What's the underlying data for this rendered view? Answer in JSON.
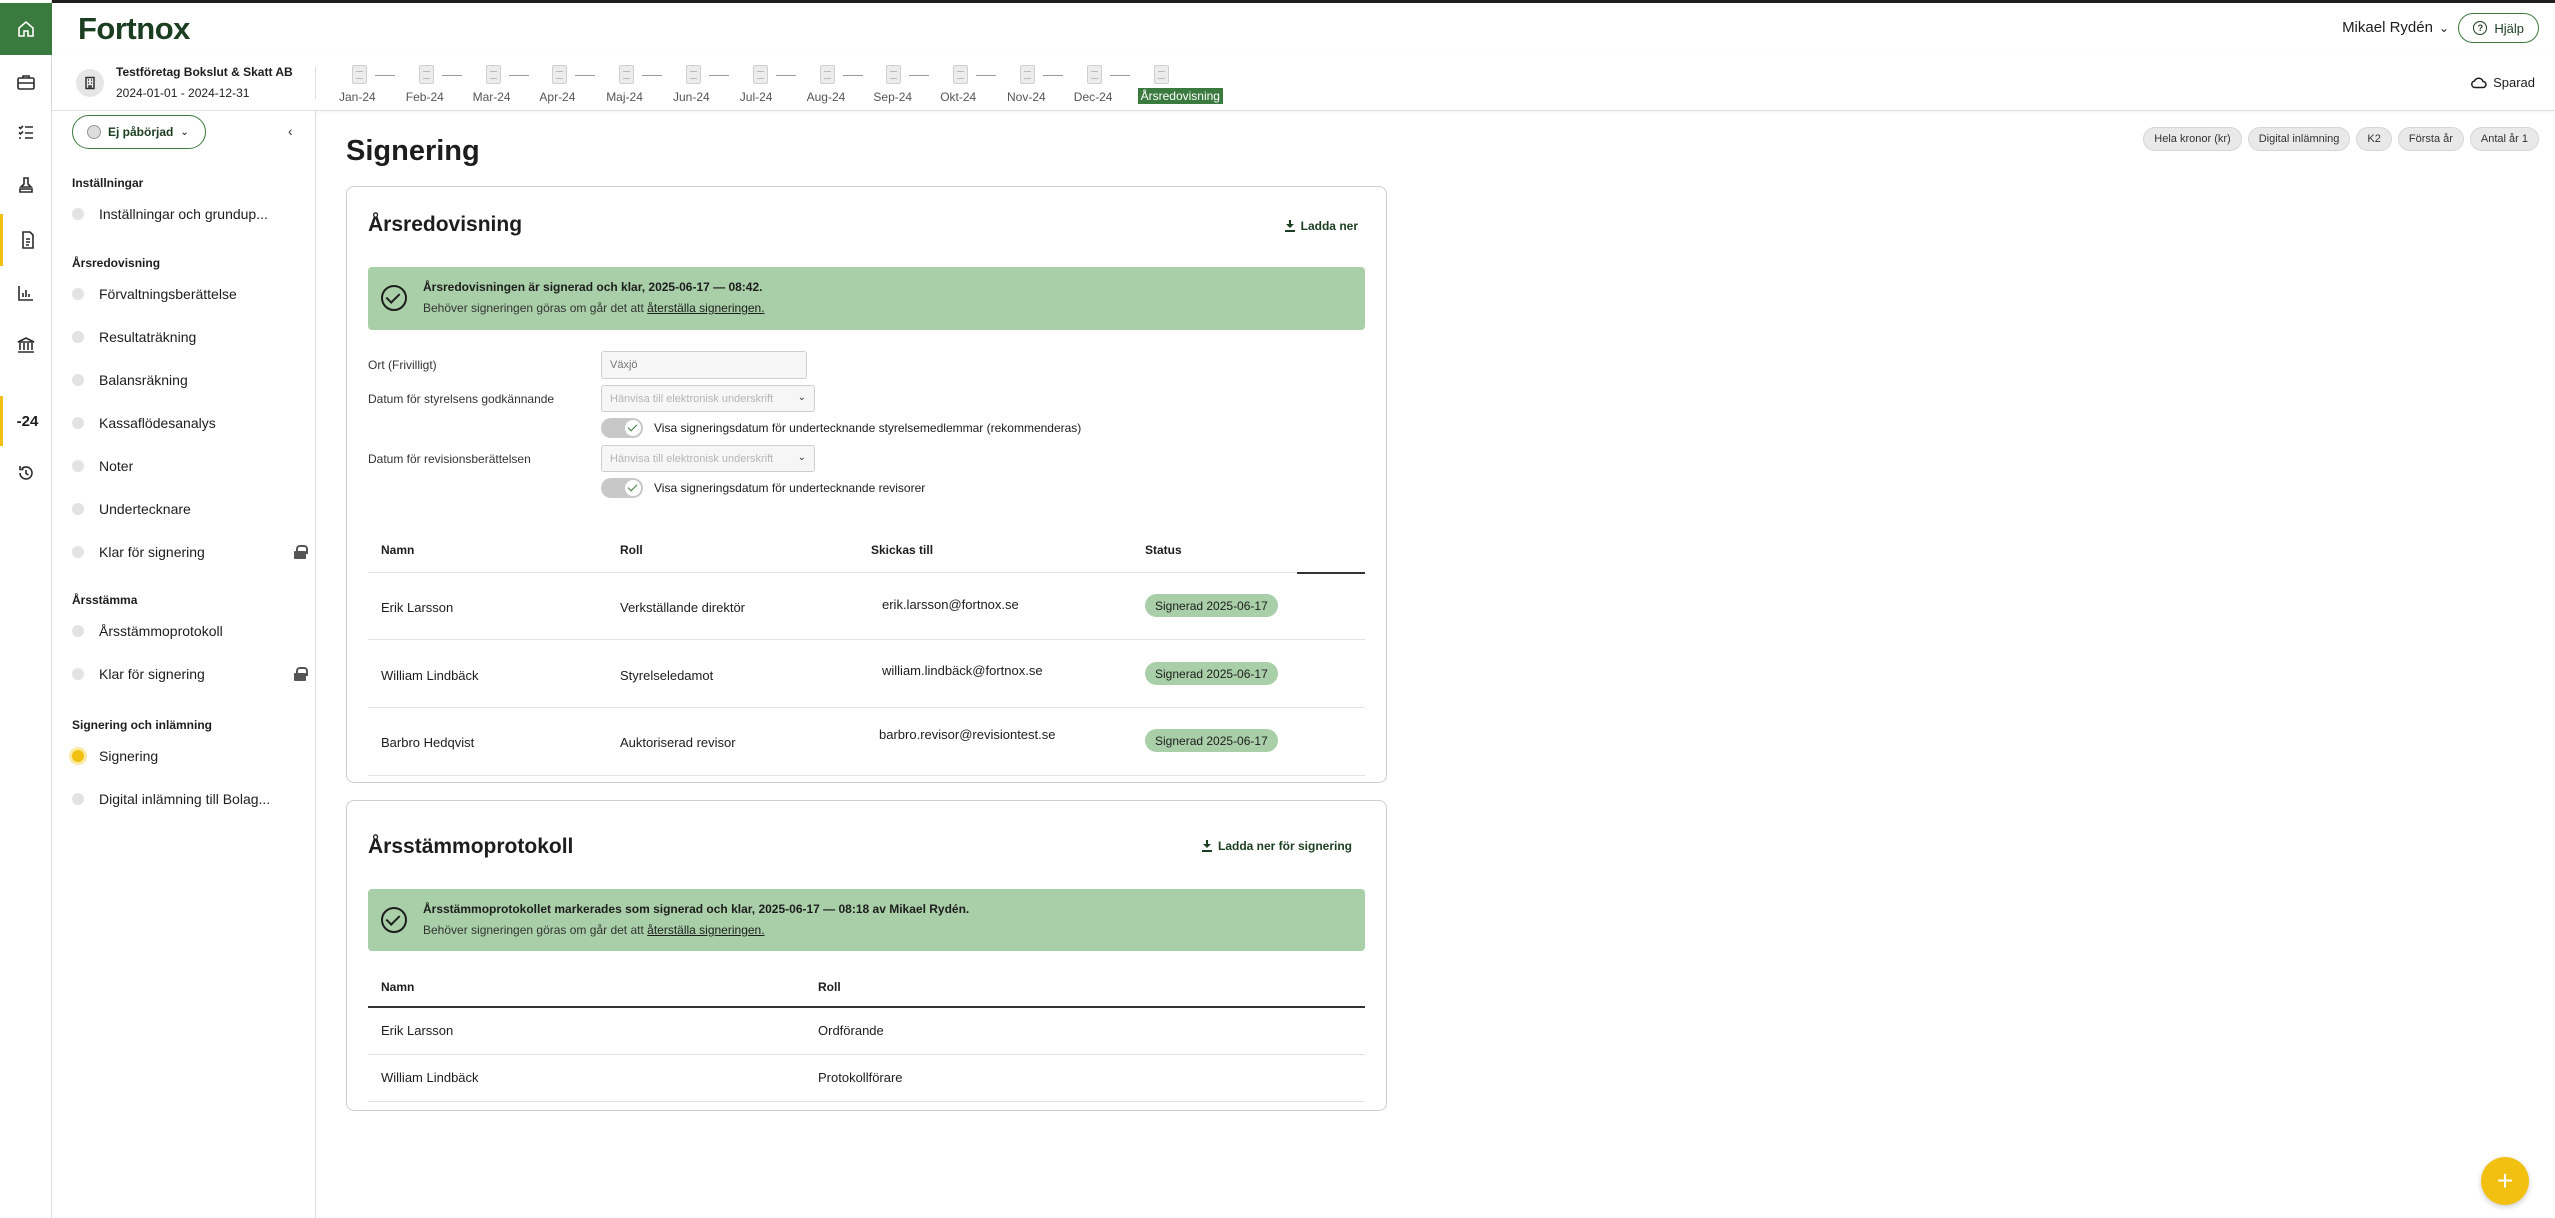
{
  "app": {
    "logo": "Fortnox"
  },
  "header": {
    "user_name": "Mikael Rydén",
    "help_label": "Hjälp"
  },
  "subheader": {
    "company_name": "Testföretag Bokslut & Skatt AB",
    "period": "2024-01-01 - 2024-12-31",
    "months": [
      "Jan-24",
      "Feb-24",
      "Mar-24",
      "Apr-24",
      "Maj-24",
      "Jun-24",
      "Jul-24",
      "Aug-24",
      "Sep-24",
      "Okt-24",
      "Nov-24",
      "Dec-24",
      "Årsredovisning"
    ],
    "active_month_index": 12,
    "saved_label": "Sparad"
  },
  "rail": {
    "year_label": "-24"
  },
  "sidebar": {
    "status_label": "Ej påbörjad",
    "sections": [
      {
        "title": "Inställningar",
        "items": [
          {
            "label": "Inställningar och grundup...",
            "locked": false
          }
        ]
      },
      {
        "title": "Årsredovisning",
        "items": [
          {
            "label": "Förvaltningsberättelse",
            "locked": false
          },
          {
            "label": "Resultaträkning",
            "locked": false
          },
          {
            "label": "Balansräkning",
            "locked": false
          },
          {
            "label": "Kassaflödesanalys",
            "locked": false
          },
          {
            "label": "Noter",
            "locked": false
          },
          {
            "label": "Undertecknare",
            "locked": false
          },
          {
            "label": "Klar för signering",
            "locked": true
          }
        ]
      },
      {
        "title": "Årsstämma",
        "items": [
          {
            "label": "Årsstämmoprotokoll",
            "locked": false
          },
          {
            "label": "Klar för signering",
            "locked": true
          }
        ]
      },
      {
        "title": "Signering och inlämning",
        "items": [
          {
            "label": "Signering",
            "locked": false,
            "current": true
          },
          {
            "label": "Digital inlämning till Bolag...",
            "locked": false
          }
        ]
      }
    ]
  },
  "main": {
    "title": "Signering",
    "tags": [
      "Hela kronor (kr)",
      "Digital inlämning",
      "K2",
      "Första år",
      "Antal år 1"
    ]
  },
  "annual_report": {
    "title": "Årsredovisning",
    "download_label": "Ladda ner",
    "alert_line1": "Årsredovisningen är signerad och klar, 2025-06-17 — 08:42.",
    "alert_line2_prefix": "Behöver signeringen göras om går det att ",
    "alert_line2_link": "återställa signeringen.",
    "city_label": "Ort (Frivilligt)",
    "city_placeholder": "Växjö",
    "board_date_label": "Datum för styrelsens godkännande",
    "board_date_value": "Hänvisa till elektronisk underskrift",
    "board_toggle_label": "Visa signeringsdatum för undertecknande styrelsemedlemmar (rekommenderas)",
    "audit_date_label": "Datum för revisionsberättelsen",
    "audit_date_value": "Hänvisa till elektronisk underskrift",
    "audit_toggle_label": "Visa signeringsdatum för undertecknande revisorer",
    "columns": [
      "Namn",
      "Roll",
      "Skickas till",
      "Status"
    ],
    "rows": [
      {
        "name": "Erik Larsson",
        "role": "Verkställande direktör",
        "email": "erik.larsson@fortnox.se",
        "status": "Signerad 2025-06-17"
      },
      {
        "name": "William Lindbäck",
        "role": "Styrelseledamot",
        "email": "william.lindbäck@fortnox.se",
        "status": "Signerad 2025-06-17"
      },
      {
        "name": "Barbro Hedqvist",
        "role": "Auktoriserad revisor",
        "email": "barbro.revisor@revisiontest.se",
        "status": "Signerad 2025-06-17"
      }
    ]
  },
  "meeting_minutes": {
    "title": "Årsstämmoprotokoll",
    "download_label": "Ladda ner för signering",
    "alert_line1": "Årsstämmoprotokollet markerades som signerad och klar, 2025-06-17 — 08:18 av Mikael Rydén.",
    "alert_line2_prefix": "Behöver signeringen göras om går det att ",
    "alert_line2_link": "återställa signeringen.",
    "columns": [
      "Namn",
      "Roll"
    ],
    "rows": [
      {
        "name": "Erik Larsson",
        "role": "Ordförande"
      },
      {
        "name": "William Lindbäck",
        "role": "Protokollförare"
      }
    ]
  },
  "fab_label": "+",
  "colors": {
    "brand_green": "#3b7a3f",
    "accent_yellow": "#f2c010",
    "success_bg": "#a9cfa9"
  }
}
